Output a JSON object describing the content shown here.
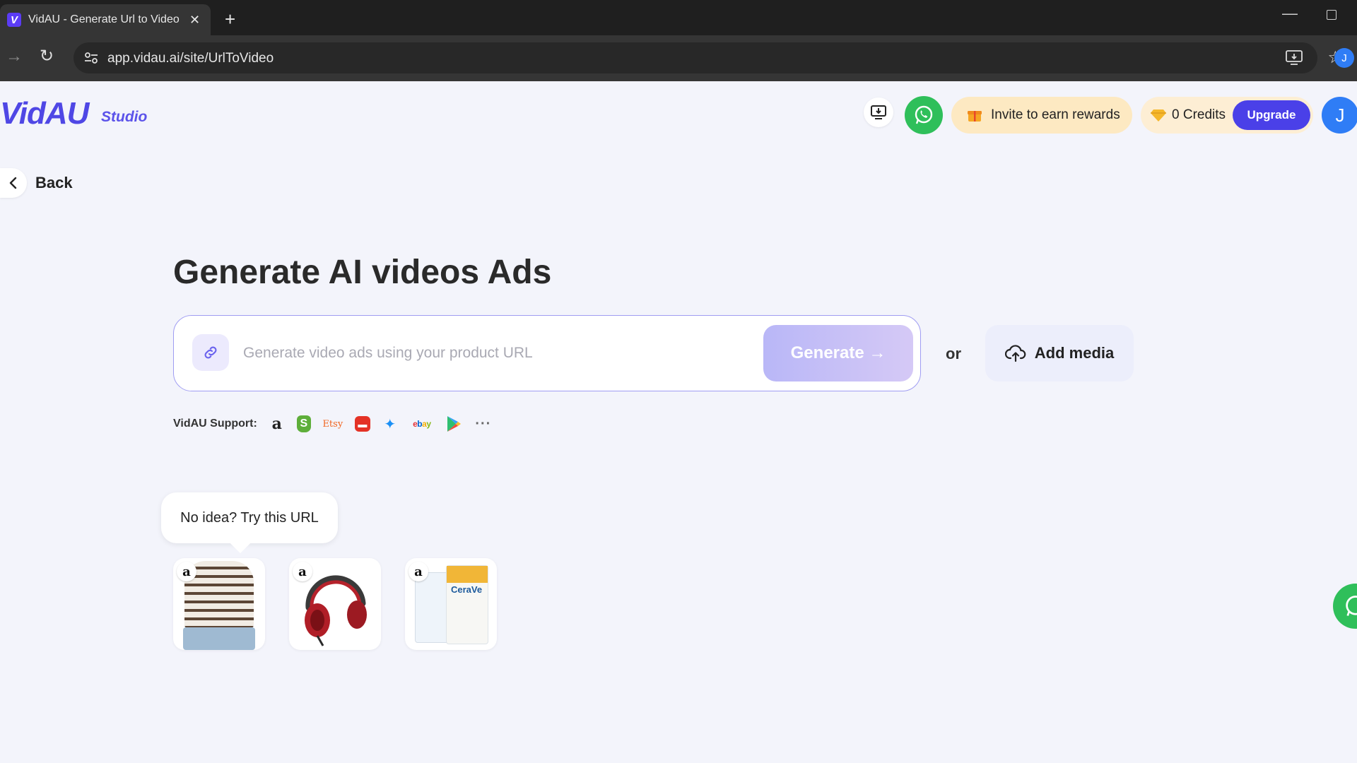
{
  "browser": {
    "tab_title": "VidAU - Generate Url to Video",
    "tab_favicon": "V",
    "url": "app.vidau.ai/site/UrlToVideo",
    "profile_initial": "J"
  },
  "header": {
    "logo": "VidAU",
    "studio": "Studio",
    "invite_label": "Invite to earn rewards",
    "credits_label": "0 Credits",
    "upgrade_label": "Upgrade",
    "avatar_initial": "J"
  },
  "back_label": "Back",
  "main": {
    "headline": "Generate AI videos Ads",
    "url_placeholder": "Generate video ads using your product URL",
    "generate_label": "Generate →",
    "or_label": "or",
    "add_media_label": "Add media",
    "support_label": "VidAU Support:",
    "platforms": {
      "etsy": "Etsy",
      "ebay": [
        "e",
        "b",
        "a",
        "y"
      ],
      "more": "···"
    },
    "idea_text": "No idea? Try this URL",
    "samples": {
      "cerave_text": "CeraVe"
    }
  },
  "colors": {
    "brand": "#4f47e5",
    "upgrade": "#4a40e8",
    "whatsapp": "#2fbf5a",
    "invite_bg": "#fde9c2",
    "generate_start": "#b9b7f7",
    "generate_end": "#d5c9f6"
  },
  "icons": [
    "tune-icon",
    "install-icon",
    "star-icon",
    "download-icon",
    "whatsapp-icon",
    "gift-icon",
    "diamond-icon",
    "chevron-left-icon",
    "link-icon",
    "cloud-upload-icon",
    "amazon-icon",
    "shopify-icon",
    "etsy-icon",
    "aliexpress-icon",
    "app-store-icon",
    "ebay-icon",
    "google-play-icon",
    "more-icon"
  ]
}
